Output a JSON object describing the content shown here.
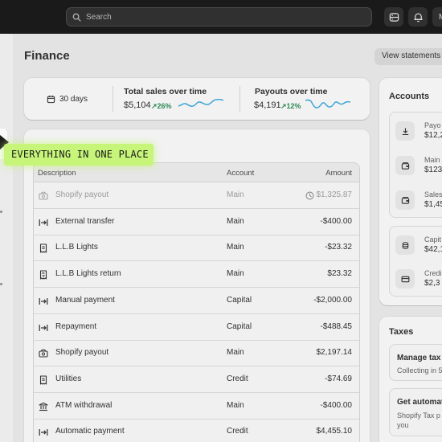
{
  "topbar": {
    "search_placeholder": "Search",
    "avatar_initial": "M"
  },
  "page": {
    "title": "Finance",
    "view_statements": "View statements"
  },
  "stats": {
    "range_label": "30 days",
    "total_sales": {
      "title": "Total sales over time",
      "value": "$5,104",
      "delta": "26%"
    },
    "payouts": {
      "title": "Payouts over time",
      "value": "$4,191",
      "delta": "12%"
    }
  },
  "banner": "EVERYTHING IN ONE PLACE",
  "transactions": {
    "columns": {
      "description": "Description",
      "account": "Account",
      "amount": "Amount"
    },
    "rows": [
      {
        "icon": "payout-icon",
        "description": "Shopify payout",
        "account": "Main",
        "amount": "$1,325.87",
        "pending": true
      },
      {
        "icon": "transfer-icon",
        "description": "External transfer",
        "account": "Main",
        "amount": "-$400.00"
      },
      {
        "icon": "receipt-icon",
        "description": "L.L.B Lights",
        "account": "Main",
        "amount": "-$23.32"
      },
      {
        "icon": "receipt-return-icon",
        "description": "L.L.B Lights return",
        "account": "Main",
        "amount": "$23.32"
      },
      {
        "icon": "transfer-icon",
        "description": "Manual payment",
        "account": "Capital",
        "amount": "-$2,000.00"
      },
      {
        "icon": "transfer-icon",
        "description": "Repayment",
        "account": "Capital",
        "amount": "-$488.45"
      },
      {
        "icon": "payout-icon",
        "description": "Shopify payout",
        "account": "Main",
        "amount": "$2,197.14"
      },
      {
        "icon": "receipt-icon",
        "description": "Utilities",
        "account": "Credit",
        "amount": "-$74.69"
      },
      {
        "icon": "bank-icon",
        "description": "ATM withdrawal",
        "account": "Main",
        "amount": "-$400.00"
      },
      {
        "icon": "transfer-icon",
        "description": "Automatic payment",
        "account": "Credit",
        "amount": "$4,455.10"
      }
    ]
  },
  "accounts": {
    "title": "Accounts",
    "items": [
      {
        "icon": "download-icon",
        "name": "Payo",
        "balance": "$12,2"
      },
      {
        "icon": "wallet-icon",
        "name": "Main",
        "balance": "$123"
      },
      {
        "icon": "wallet-icon",
        "name": "Sales",
        "balance": "$1,45"
      },
      {
        "icon": "coins-icon",
        "name": "Capit",
        "balance": "$42,1"
      },
      {
        "icon": "credit-card-icon",
        "name": "Credi",
        "balance": "$2,3"
      }
    ]
  },
  "taxes": {
    "title": "Taxes",
    "items": [
      {
        "title": "Manage tax c",
        "subtitle": "Collecting in 5"
      },
      {
        "title": "Get automat",
        "subtitle": "Shopify Tax p",
        "subtitle2": "you"
      }
    ]
  },
  "colors": {
    "accent_green": "#2e8a57",
    "sparkline_blue": "#3ea6d6",
    "banner_green": "#c6f57a",
    "topbar": "#1a1a1a"
  }
}
